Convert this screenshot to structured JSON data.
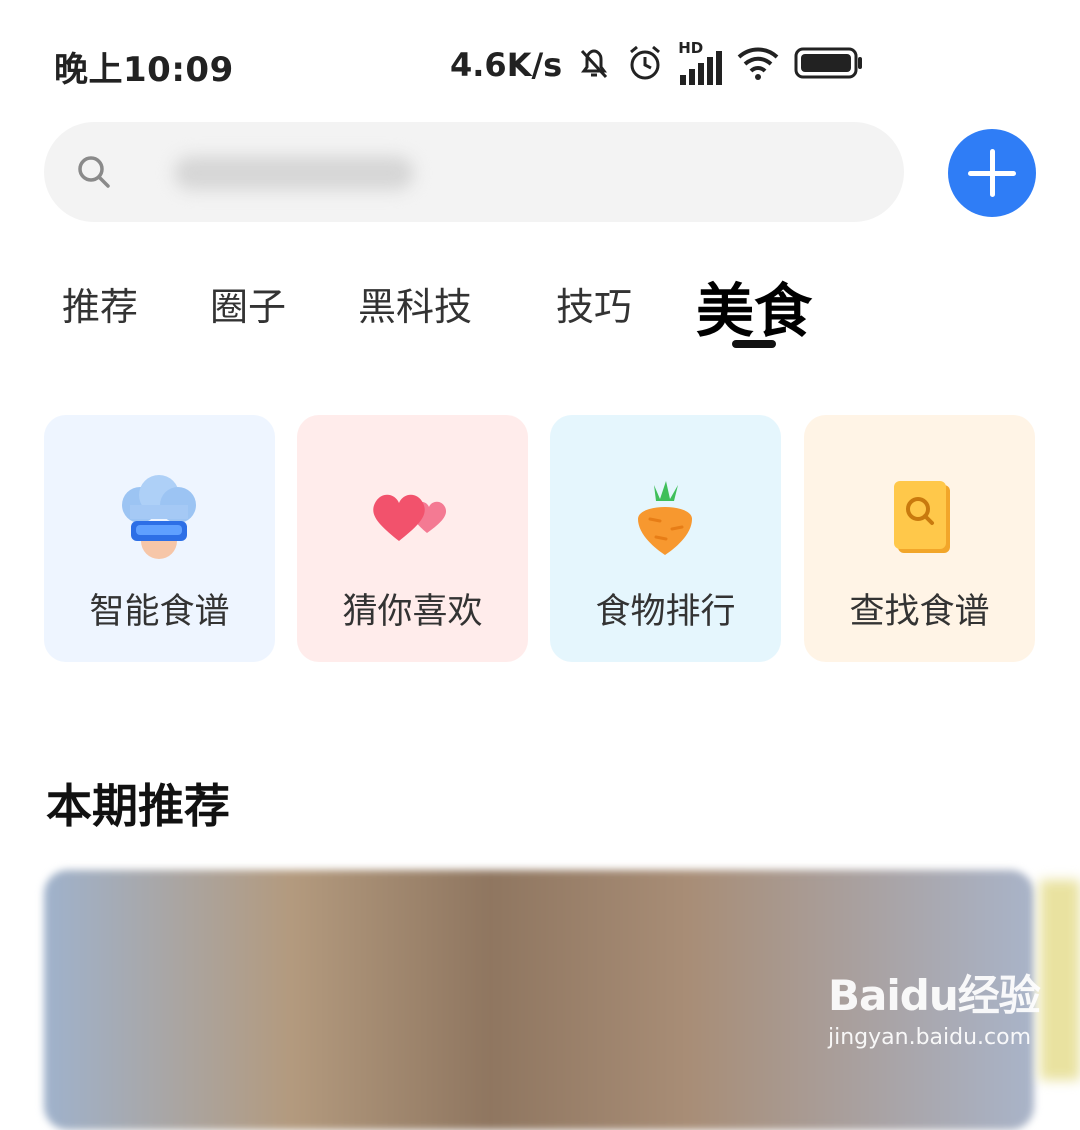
{
  "status_bar": {
    "time": "晚上10:09",
    "speed": "4.6K/s",
    "network_label": "HD",
    "icons": [
      "mute-bell-icon",
      "alarm-icon",
      "signal-icon",
      "wifi-icon",
      "battery-icon"
    ]
  },
  "search": {
    "placeholder": ""
  },
  "tabs": [
    {
      "label": "推荐",
      "active": false
    },
    {
      "label": "圈子",
      "active": false
    },
    {
      "label": "黑科技",
      "active": false
    },
    {
      "label": "技巧",
      "active": false
    },
    {
      "label": "美食",
      "active": true
    }
  ],
  "cards": [
    {
      "label": "智能食谱",
      "icon": "chef-hat-icon",
      "bg": "#eef5ff"
    },
    {
      "label": "猜你喜欢",
      "icon": "hearts-icon",
      "bg": "#ffeceb"
    },
    {
      "label": "食物排行",
      "icon": "carrot-icon",
      "bg": "#e5f6fd"
    },
    {
      "label": "查找食谱",
      "icon": "recipe-book-search-icon",
      "bg": "#fff4e6"
    }
  ],
  "section": {
    "title": "本期推荐"
  },
  "watermark": {
    "brand": "Baidu经验",
    "url": "jingyan.baidu.com"
  },
  "colors": {
    "accent": "#2f7df6"
  }
}
